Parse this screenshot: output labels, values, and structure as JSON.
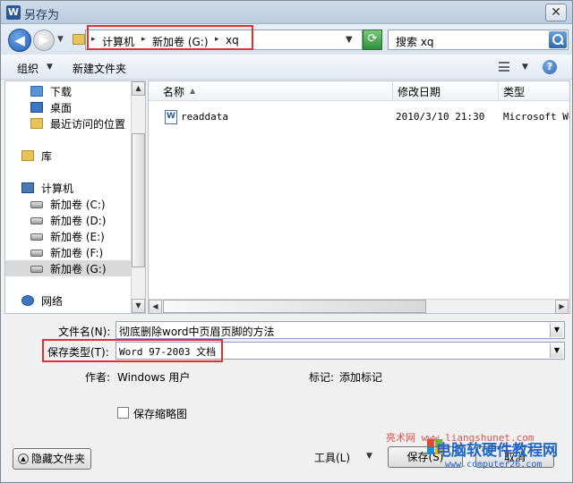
{
  "window": {
    "title": "另存为",
    "app_icon": "W",
    "close_label": "✕"
  },
  "address": {
    "crumbs": [
      "计算机",
      "新加卷 (G:)",
      "xq"
    ],
    "search_text": "搜索 xq"
  },
  "toolbar": {
    "organize_label": "组织",
    "new_folder_label": "新建文件夹"
  },
  "nav": {
    "items": [
      {
        "label": "下载",
        "icon": "download-folder-icon"
      },
      {
        "label": "桌面",
        "icon": "desktop-icon"
      },
      {
        "label": "最近访问的位置",
        "icon": "recent-places-icon"
      },
      {
        "label": "库",
        "icon": "library-icon"
      },
      {
        "label": "计算机",
        "icon": "computer-icon"
      },
      {
        "label": "新加卷 (C:)",
        "icon": "drive-icon"
      },
      {
        "label": "新加卷 (D:)",
        "icon": "drive-icon"
      },
      {
        "label": "新加卷 (E:)",
        "icon": "drive-icon"
      },
      {
        "label": "新加卷 (F:)",
        "icon": "drive-icon"
      },
      {
        "label": "新加卷 (G:)",
        "icon": "drive-icon"
      },
      {
        "label": "网络",
        "icon": "network-icon"
      }
    ],
    "selected": "新加卷 (G:)"
  },
  "filelist": {
    "columns": [
      "名称",
      "修改日期",
      "类型"
    ],
    "rows": [
      {
        "name": "readdata",
        "date": "2010/3/10 21:30",
        "type": "Microsoft Wor"
      }
    ]
  },
  "form": {
    "filename_label": "文件名(N):",
    "filename_value": "彻底删除word中页眉页脚的方法",
    "savetype_label": "保存类型(T):",
    "savetype_value": "Word 97-2003 文档",
    "author_label": "作者:",
    "author_value": "Windows 用户",
    "tags_label": "标记:",
    "tags_value": "添加标记",
    "thumbnail_label": "保存缩略图"
  },
  "buttons": {
    "hide_folders": "隐藏文件夹",
    "tools": "工具(L)",
    "save": "保存(S)",
    "cancel": "取消"
  },
  "watermark": {
    "line1": "亮术网 www.liangshunet.com",
    "line2": "电脑软硬件教程网",
    "line3": "www.computer26.com"
  }
}
